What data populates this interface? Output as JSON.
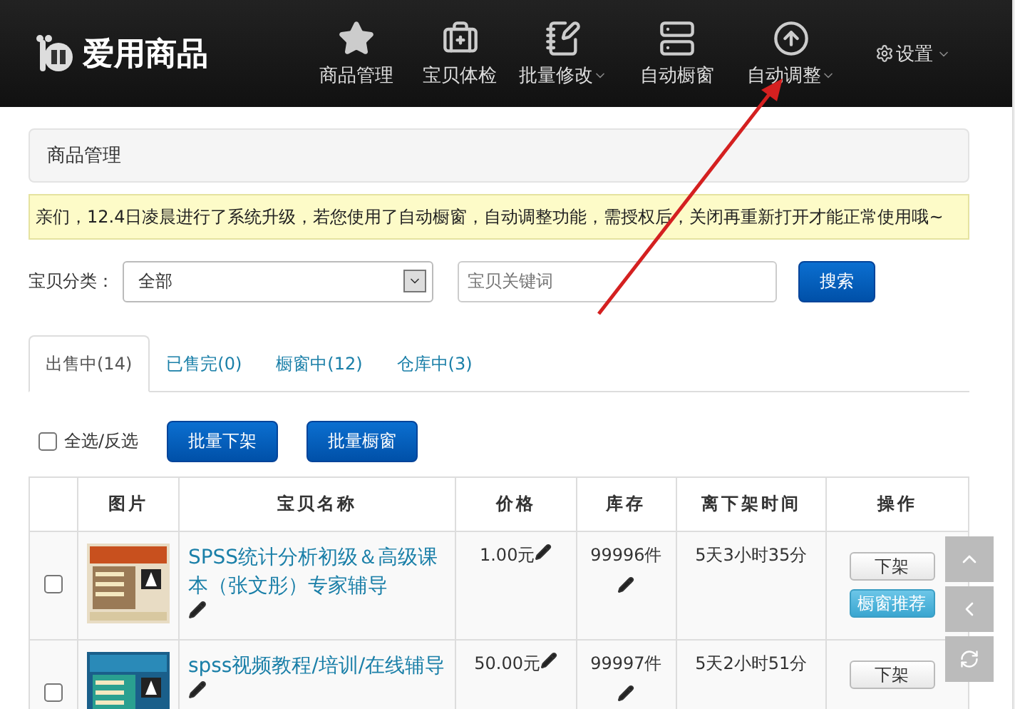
{
  "logo": "爱用商品",
  "nav": [
    {
      "label": "商品管理",
      "dropdown": false
    },
    {
      "label": "宝贝体检",
      "dropdown": false
    },
    {
      "label": "批量修改",
      "dropdown": true
    },
    {
      "label": "自动橱窗",
      "dropdown": false
    },
    {
      "label": "自动调整",
      "dropdown": true
    }
  ],
  "settings": {
    "label": "设置",
    "dropdown": true
  },
  "panel_title": "商品管理",
  "notice": "亲们，12.4日凌晨进行了系统升级，若您使用了自动橱窗，自动调整功能，需授权后，关闭再重新打开才能正常使用哦~",
  "filter": {
    "label": "宝贝分类：",
    "category": "全部",
    "keyword_placeholder": "宝贝关键词",
    "search_button": "搜索"
  },
  "tabs": [
    {
      "label": "出售中(14)",
      "selected": true
    },
    {
      "label": "已售完(0)",
      "selected": false
    },
    {
      "label": "橱窗中(12)",
      "selected": false
    },
    {
      "label": "仓库中(3)",
      "selected": false
    }
  ],
  "bulk": {
    "select_all": {
      "label": "全选/反选",
      "checked": false
    },
    "buttons": [
      "批量下架",
      "批量橱窗"
    ]
  },
  "table": {
    "columns": [
      "图片",
      "宝贝名称",
      "价格",
      "库存",
      "离下架时间",
      "操作"
    ],
    "rows": [
      {
        "checked": false,
        "picture": {
          "kind": "picture"
        },
        "name": "SPSS统计分析初级＆高级课本（张文彤）专家辅导",
        "price": "1.00元",
        "stock": "99996件",
        "time": "5天3小时35分",
        "actions": [
          {
            "label": "下架",
            "kind": "plain"
          },
          {
            "label": "橱窗推荐",
            "kind": "primary"
          }
        ]
      },
      {
        "checked": false,
        "picture": {
          "kind": "picture"
        },
        "name": "spss视频教程/培训/在线辅导",
        "price": "50.00元",
        "stock": "99997件",
        "time": "5天2小时51分",
        "actions": [
          {
            "label": "下架",
            "kind": "plain"
          }
        ]
      }
    ]
  },
  "annotation": {
    "kind": "arrow"
  }
}
